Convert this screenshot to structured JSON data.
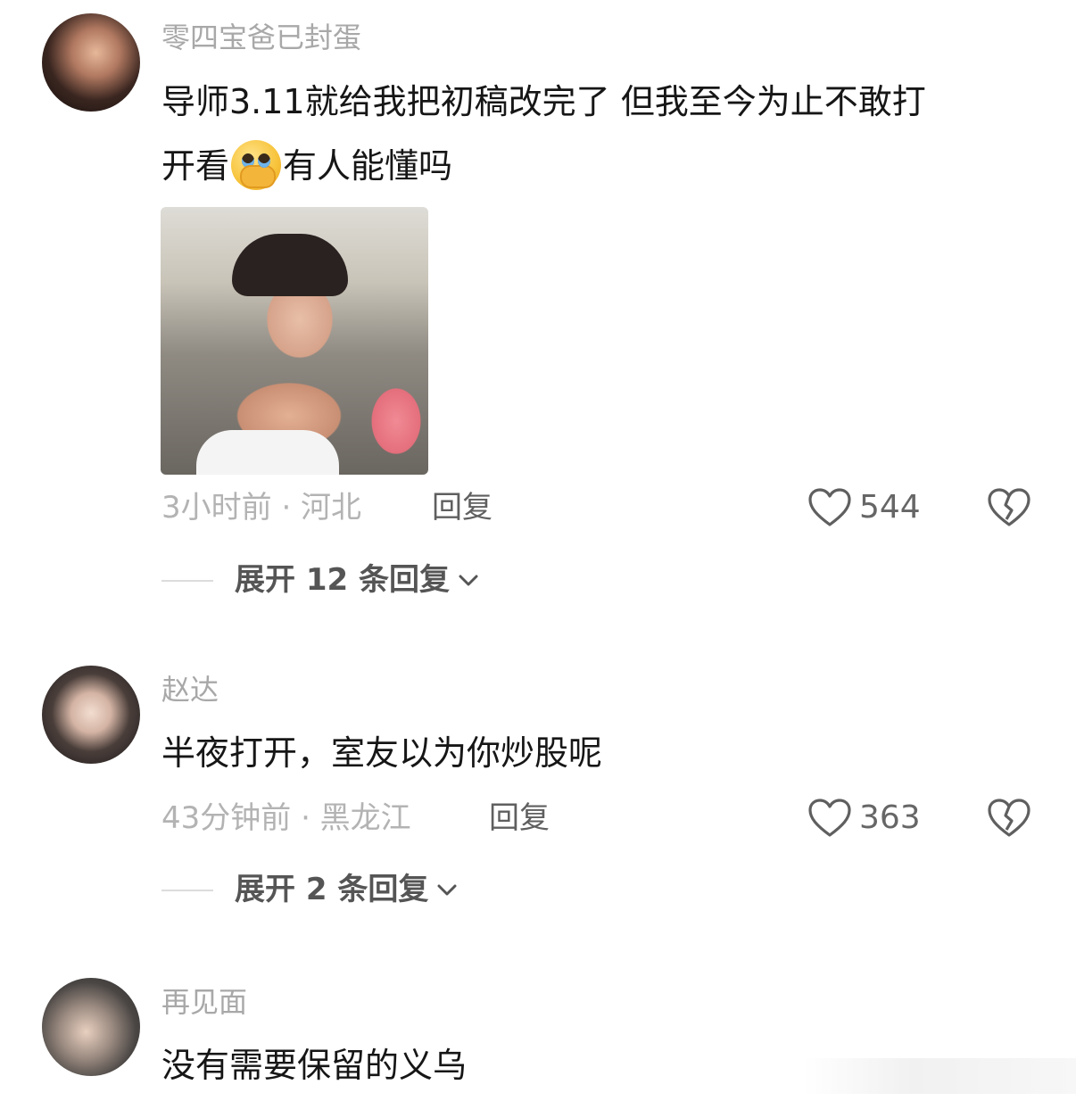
{
  "comments": [
    {
      "username": "零四宝爸已封蛋",
      "text_line1": "导师3.11就给我把初稿改完了 但我至今为止不敢打",
      "text_line2_before": "开看",
      "emoji_icon": "hand-over-mouth-crying-emoji",
      "text_line2_after": "有人能懂吗",
      "time_location": "3小时前 · 河北",
      "reply_label": "回复",
      "like_count": "544",
      "expand_label": "展开 12 条回复"
    },
    {
      "username": "赵达",
      "text": "半夜打开，室友以为你炒股呢",
      "time_location": "43分钟前 · 黑龙江",
      "reply_label": "回复",
      "like_count": "363",
      "expand_label": "展开 2 条回复"
    },
    {
      "username": "再见面",
      "text": "没有需要保留的义乌"
    }
  ],
  "colors": {
    "text_primary": "#161616",
    "text_muted": "#a8a8a8",
    "icon_gray": "#5f5f5f"
  }
}
